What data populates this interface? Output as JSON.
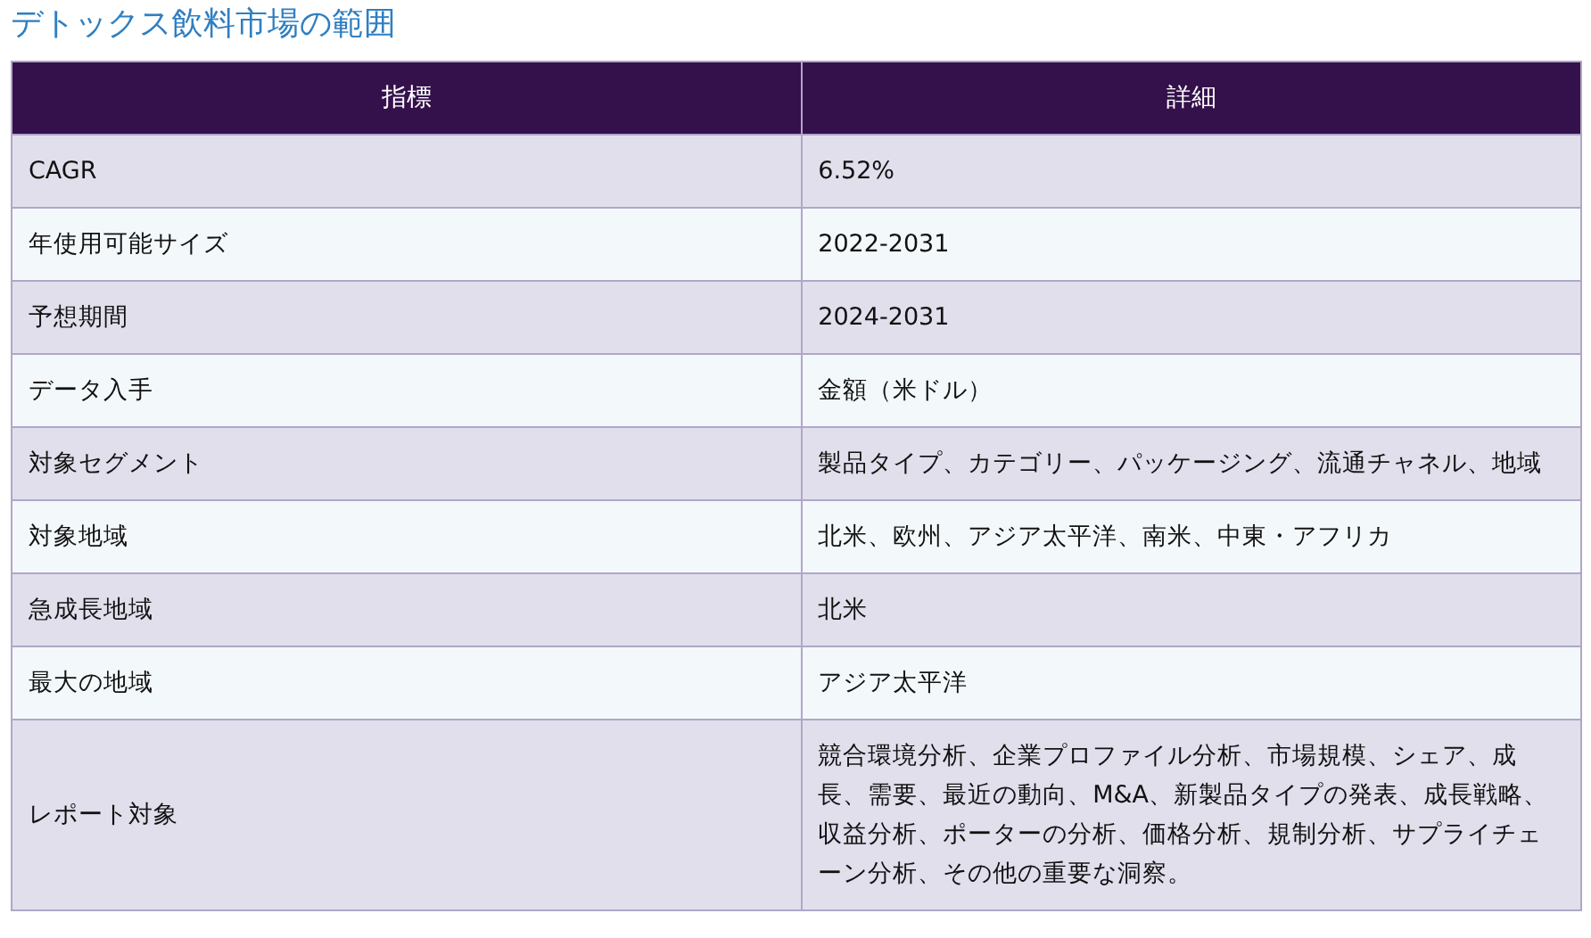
{
  "title": "デトックス飲料市場の範囲",
  "table": {
    "columns": [
      "指標",
      "詳細"
    ],
    "rows": [
      [
        "CAGR",
        "6.52%"
      ],
      [
        "年使用可能サイズ",
        "2022-2031"
      ],
      [
        "予想期間",
        "2024-2031"
      ],
      [
        "データ入手",
        "金額（米ドル）"
      ],
      [
        "対象セグメント",
        "製品タイプ、カテゴリー、パッケージング、流通チャネル、地域"
      ],
      [
        "対象地域",
        "北米、欧州、アジア太平洋、南米、中東・アフリカ"
      ],
      [
        "急成長地域",
        "北米"
      ],
      [
        "最大の地域",
        "アジア太平洋"
      ],
      [
        "レポート対象",
        "競合環境分析、企業プロファイル分析、市場規模、シェア、成長、需要、最近の動向、M&A、新製品タイプの発表、成長戦略、収益分析、ポーターの分析、価格分析、規制分析、サプライチェーン分析、その他の重要な洞察。"
      ]
    ]
  }
}
